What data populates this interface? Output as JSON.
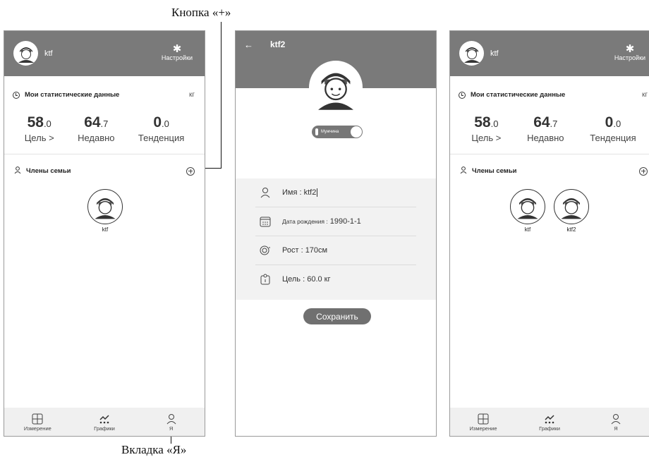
{
  "annotations": {
    "top": "Кнопка «+»",
    "bottom": "Вкладка «Я»"
  },
  "screens": {
    "left": {
      "username": "ktf",
      "settings_label": "Настройки",
      "stats_title": "Мои статистические данные",
      "unit": "кг",
      "stats": [
        {
          "int": "58",
          "dec": ".0",
          "label": "Цель >"
        },
        {
          "int": "64",
          "dec": ".7",
          "label": "Недавно"
        },
        {
          "int": "0",
          "dec": ".0",
          "label": "Тенденция"
        }
      ],
      "family_title": "Члены семьи",
      "members": [
        "ktf"
      ],
      "tabs": [
        "Измерение",
        "Графики",
        "Я"
      ]
    },
    "middle": {
      "back_icon": "←",
      "title": "ktf2",
      "gender_label": "Мужчина",
      "fields": [
        {
          "label": "Имя :",
          "value": "ktf2"
        },
        {
          "label": "Дата рождения :",
          "value": "1990-1-1"
        },
        {
          "label": "Рост :",
          "value": "170см"
        },
        {
          "label": "Цель :",
          "value": "60.0 кг"
        }
      ],
      "save_label": "Сохранить"
    },
    "right": {
      "username": "ktf",
      "settings_label": "Настройки",
      "stats_title": "Мои статистические данные",
      "unit": "кг",
      "stats": [
        {
          "int": "58",
          "dec": ".0",
          "label": "Цель >"
        },
        {
          "int": "64",
          "dec": ".7",
          "label": "Недавно"
        },
        {
          "int": "0",
          "dec": ".0",
          "label": "Тенденция"
        }
      ],
      "family_title": "Члены семьи",
      "members": [
        "ktf",
        "ktf2"
      ],
      "tabs": [
        "Измерение",
        "Графики",
        "Я"
      ]
    }
  }
}
